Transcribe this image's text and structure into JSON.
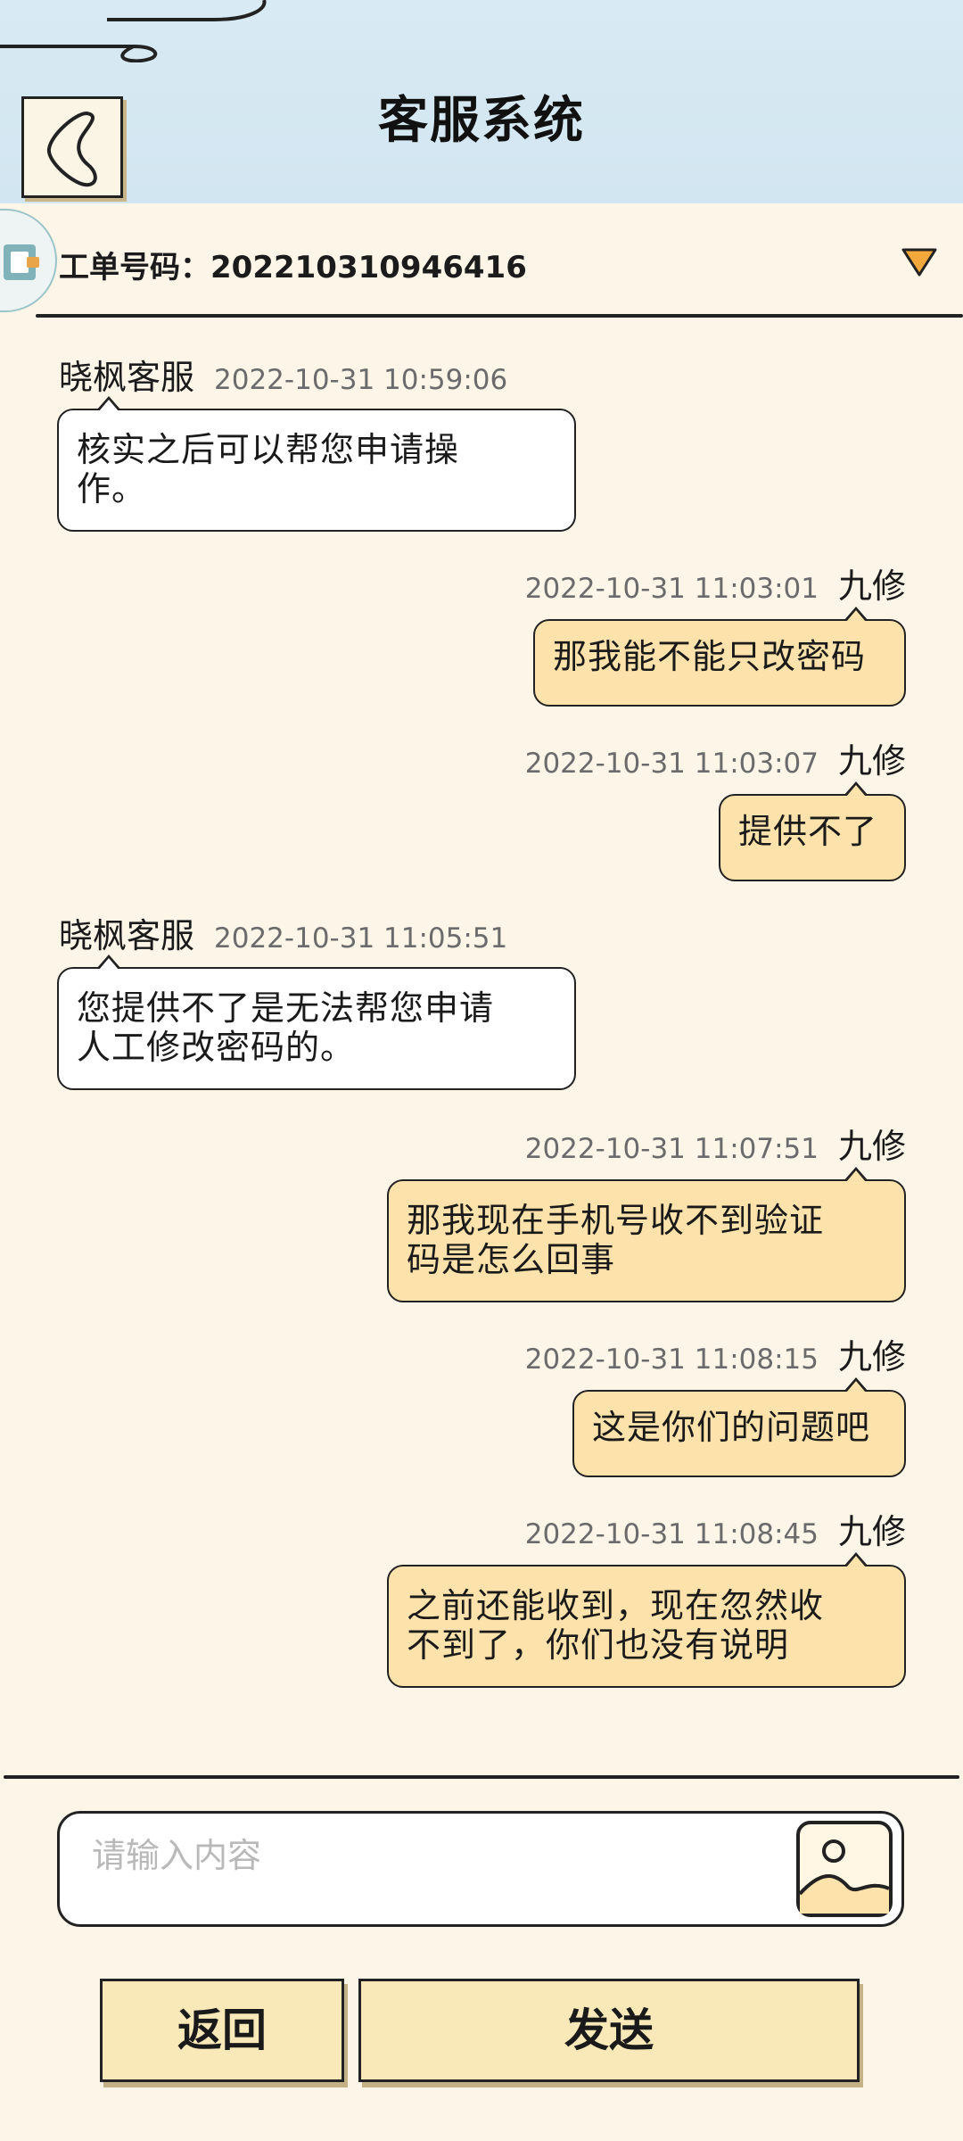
{
  "header": {
    "title": "客服系统"
  },
  "ticket": {
    "label": "工单号码：202210310946416"
  },
  "messages": [
    {
      "side": "left",
      "sender": "晓枫客服",
      "time": "2022-10-31 10:59:06",
      "lines": [
        "核实之后可以帮您申请操",
        "作。"
      ]
    },
    {
      "side": "right",
      "sender": "九修",
      "time": "2022-10-31 11:03:01",
      "lines": [
        "那我能不能只改密码"
      ]
    },
    {
      "side": "right",
      "sender": "九修",
      "time": "2022-10-31 11:03:07",
      "lines": [
        "提供不了"
      ]
    },
    {
      "side": "left",
      "sender": "晓枫客服",
      "time": "2022-10-31 11:05:51",
      "lines": [
        "您提供不了是无法帮您申请",
        "人工修改密码的。"
      ]
    },
    {
      "side": "right",
      "sender": "九修",
      "time": "2022-10-31 11:07:51",
      "lines": [
        "那我现在手机号收不到验证",
        "码是怎么回事"
      ]
    },
    {
      "side": "right",
      "sender": "九修",
      "time": "2022-10-31 11:08:15",
      "lines": [
        "这是你们的问题吧"
      ]
    },
    {
      "side": "right",
      "sender": "九修",
      "time": "2022-10-31 11:08:45",
      "lines": [
        "之前还能收到，现在忽然收",
        "不到了，你们也没有说明"
      ]
    }
  ],
  "input": {
    "placeholder": "请输入内容"
  },
  "buttons": {
    "back": "返回",
    "send": "发送"
  },
  "colors": {
    "header_bg": "#d8eaf3",
    "page_bg": "#fdf6e8",
    "right_bubble": "#fde3ab",
    "button_bg": "#fae9b8"
  },
  "icons": {
    "back": "chevron-left-icon",
    "dropdown": "triangle-down-icon",
    "image": "image-icon",
    "ticket": "ticket-icon"
  }
}
